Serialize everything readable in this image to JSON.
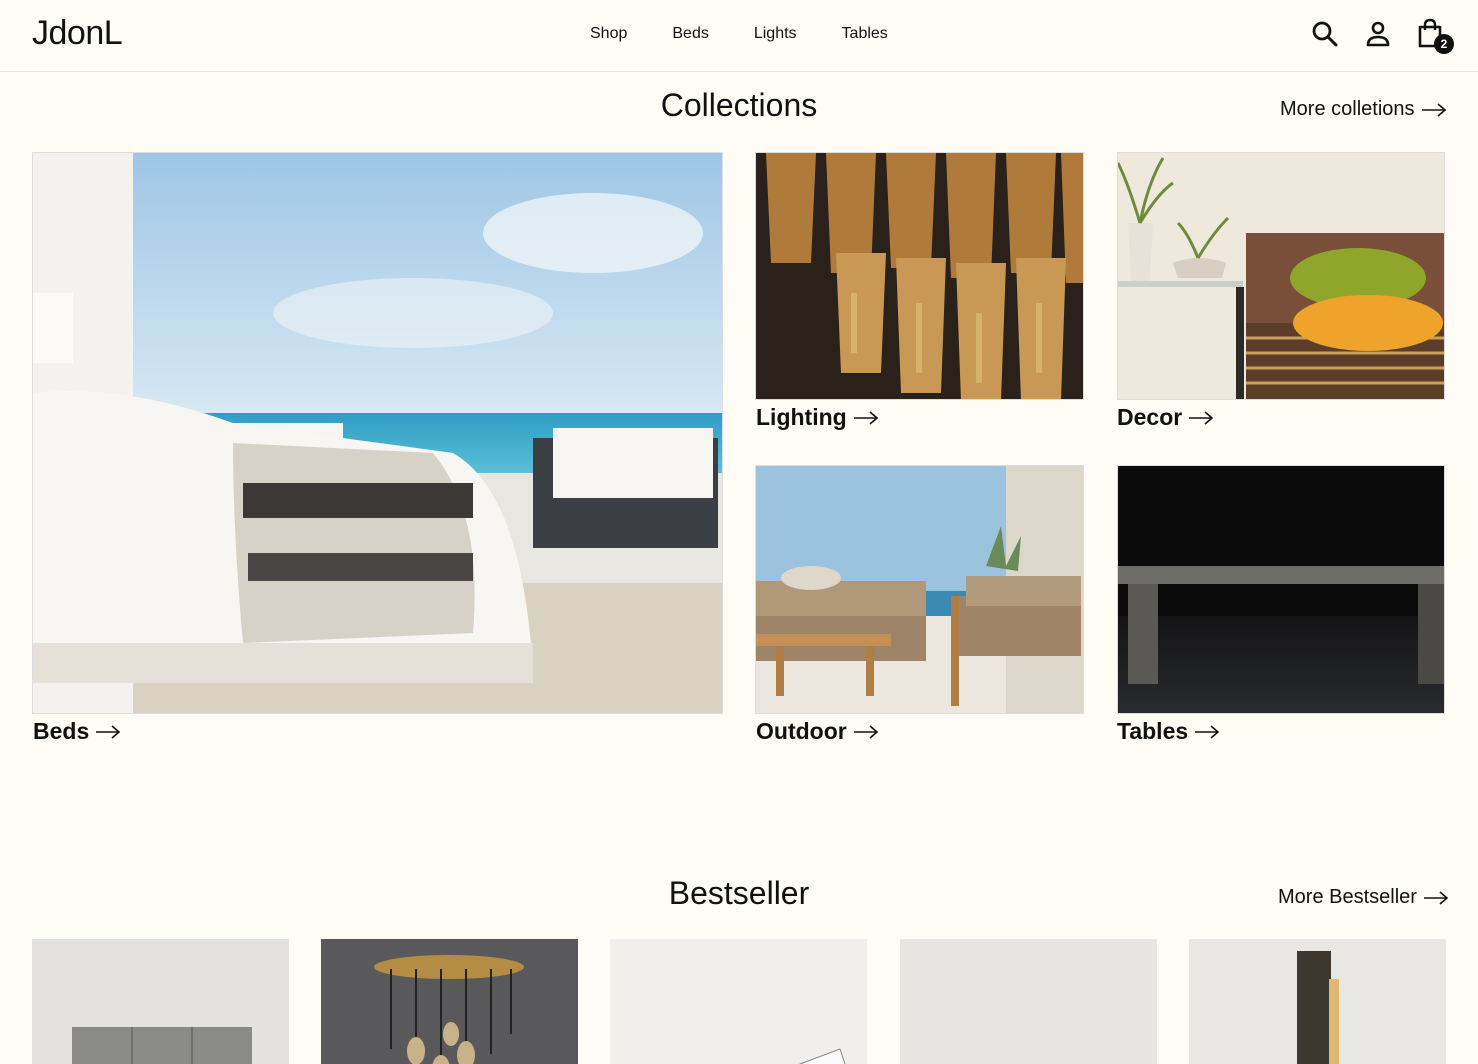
{
  "header": {
    "logo": "JdonL",
    "nav": [
      "Shop",
      "Beds",
      "Lights",
      "Tables"
    ],
    "cart_count": "2",
    "icons": [
      "search-icon",
      "account-icon",
      "bag-icon"
    ]
  },
  "collections": {
    "title": "Collections",
    "more": "More colletions",
    "cards": [
      {
        "label": "Beds"
      },
      {
        "label": "Lighting"
      },
      {
        "label": "Decor"
      },
      {
        "label": "Outdoor"
      },
      {
        "label": "Tables"
      }
    ]
  },
  "bestseller": {
    "title": "Bestseller",
    "more": "More Bestseller"
  },
  "colors": {
    "background": "#fffcf5",
    "text": "#111111"
  }
}
